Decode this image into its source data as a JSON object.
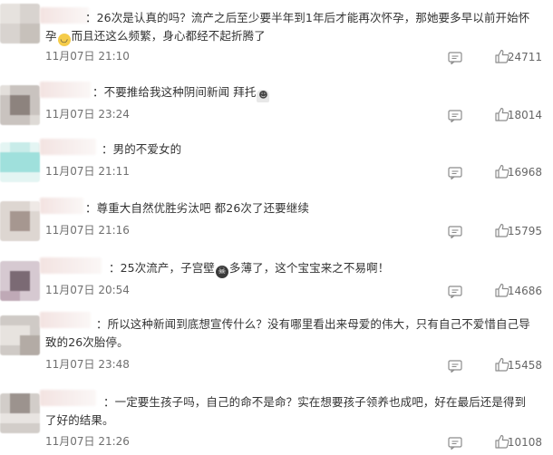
{
  "comments": [
    {
      "text": "：26次是认真的吗？流产之后至少要半年到1年后才能再次怀孕，那她要多早以前开始怀孕",
      "text_tail": "而且还这么频繁，身心都经不起折腾了",
      "emoji": "laugh-cry-emoji",
      "time": "11月07日 21:10",
      "likes": "24711"
    },
    {
      "text": "：不要推给我这种阴间新闻 拜托",
      "emoji": "ghost-emoji",
      "time": "11月07日 23:24",
      "likes": "18014"
    },
    {
      "text": "：男的不爱女的",
      "time": "11月07日 21:11",
      "likes": "16968"
    },
    {
      "text": "：尊重大自然优胜劣汰吧 都26次了还要继续",
      "time": "11月07日 21:16",
      "likes": "15795"
    },
    {
      "text": "：25次流产，子宫壁",
      "text_tail": "多薄了，这个宝宝来之不易啊！",
      "emoji": "skull-emoji",
      "time": "11月07日 20:54",
      "likes": "14686"
    },
    {
      "text": "：所以这种新闻到底想宣传什么？没有哪里看出来母爱的伟大，只有自己不爱惜自己导致的26次胎停。",
      "time": "11月07日 23:48",
      "likes": "15458"
    },
    {
      "text": "：一定要生孩子吗，自己的命不是命？实在想要孩子领养也成吧，好在最后还是得到了好的结果。",
      "time": "11月07日 21:26",
      "likes": "10108"
    }
  ],
  "colors": {
    "text": "#333333",
    "meta": "#6f6f6f",
    "icon": "#8c8c8c"
  }
}
